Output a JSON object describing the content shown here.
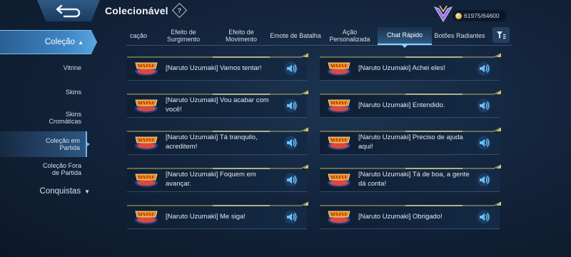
{
  "header": {
    "title": "Colecionável",
    "help_glyph": "?",
    "currency_value": "61975/64600"
  },
  "sidebar": {
    "main_label": "Coleção",
    "items": [
      {
        "label": "Vitrine"
      },
      {
        "label": "Skins"
      },
      {
        "label": "Skins\nCromáticas"
      },
      {
        "label": "Coleção em\nPartida"
      },
      {
        "label": "Coleção Fora\nde Partida"
      }
    ],
    "active_index": 3,
    "group_label": "Conquistas"
  },
  "tabs": [
    {
      "label": "cação"
    },
    {
      "label": "Efeito de\nSurgimento"
    },
    {
      "label": "Efeito de\nMovimento"
    },
    {
      "label": "Emote de Batalha"
    },
    {
      "label": "Ação\nPersonalizada"
    },
    {
      "label": "Chat Rápido"
    },
    {
      "label": "Botões Radiantes"
    }
  ],
  "active_tab": 5,
  "chat_items": [
    {
      "text": "[Naruto Uzumaki] Vamos tentar!"
    },
    {
      "text": "[Naruto Uzumaki] Achei eles!"
    },
    {
      "text": "[Naruto Uzumaki] Vou acabar com você!"
    },
    {
      "text": "[Naruto Uzumaki] Entendido."
    },
    {
      "text": "[Naruto Uzumaki] Tá tranquilo, acreditem!"
    },
    {
      "text": "[Naruto Uzumaki] Preciso de ajuda aqui!"
    },
    {
      "text": "[Naruto Uzumaki] Foquem em avançar."
    },
    {
      "text": "[Naruto Uzumaki] Tá de boa, a gente dá conta!"
    },
    {
      "text": "[Naruto Uzumaki] Me siga!"
    },
    {
      "text": "[Naruto Uzumaki] Obrigado!"
    }
  ],
  "icons": {
    "back": "back-arrow-icon",
    "help": "help-icon",
    "filter": "filter-icon",
    "speaker": "speaker-icon",
    "logo": "naruto-logo-icon",
    "coin": "coin-icon",
    "emblem": "rank-emblem-icon"
  },
  "colors": {
    "accent": "#4fa3e0",
    "speaker": "#5fb3f0",
    "logo_orange": "#f08a1c"
  }
}
